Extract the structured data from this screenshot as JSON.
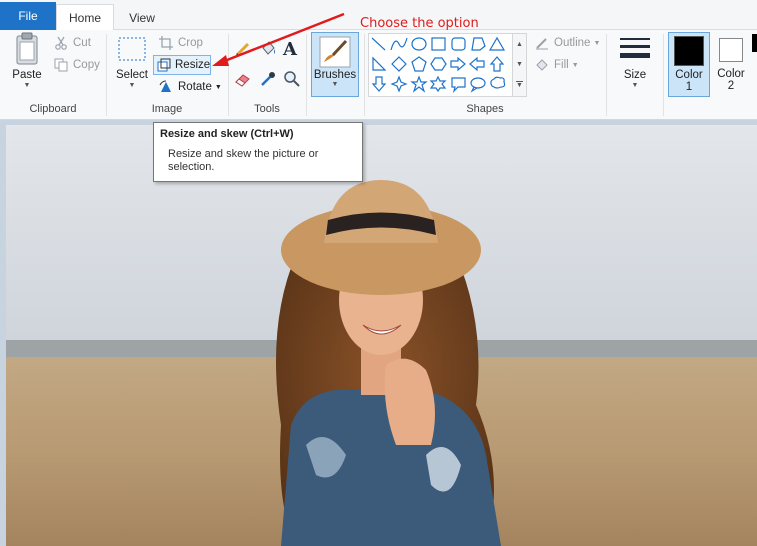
{
  "tabs": {
    "file": "File",
    "home": "Home",
    "view": "View"
  },
  "clipboard": {
    "paste": "Paste",
    "cut": "Cut",
    "copy": "Copy",
    "group": "Clipboard"
  },
  "image": {
    "select": "Select",
    "crop": "Crop",
    "resize": "Resize",
    "rotate": "Rotate",
    "group": "Image"
  },
  "tools": {
    "group": "Tools"
  },
  "brushes": {
    "label": "Brushes"
  },
  "shapes": {
    "outline": "Outline",
    "fill": "Fill",
    "group": "Shapes",
    "gallery_icons": [
      "line-shape",
      "curve-shape",
      "oval-shape",
      "rectangle-shape",
      "rounded-rectangle-shape",
      "polygon-shape",
      "triangle-shape",
      "right-triangle-shape",
      "diamond-shape",
      "pentagon-shape",
      "hexagon-shape",
      "right-arrow-shape",
      "left-arrow-shape",
      "up-arrow-shape",
      "down-arrow-shape",
      "four-point-star-shape",
      "five-point-star-shape",
      "six-point-star-shape",
      "rounded-callout-shape",
      "oval-callout-shape",
      "cloud-callout-shape"
    ]
  },
  "size": {
    "label": "Size"
  },
  "colors": {
    "color1_line1": "Color",
    "color1_line2": "1",
    "color2_line1": "Color",
    "color2_line2": "2",
    "color1_value": "#000000",
    "color2_value": "#ffffff",
    "accent": "#1e73c9",
    "annotation": "#e11b1b"
  },
  "tooltip": {
    "title": "Resize and skew (Ctrl+W)",
    "desc_line1": "Resize and skew the picture or",
    "desc_line2": "selection."
  },
  "annotation": {
    "text": "Choose the option"
  }
}
